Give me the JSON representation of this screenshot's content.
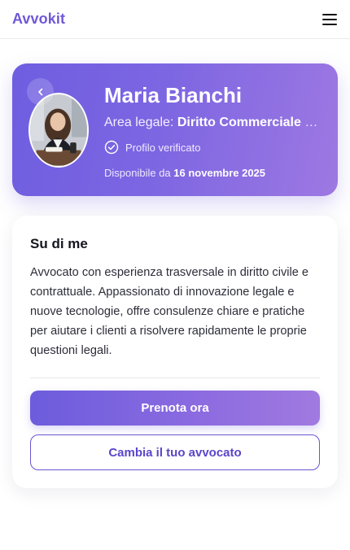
{
  "header": {
    "brand": "Avvokit",
    "menu_icon": "hamburger-menu-icon"
  },
  "profile": {
    "back_icon": "chevron-left-icon",
    "avatar_alt": "Maria Bianchi",
    "name": "Maria Bianchi",
    "area_label": "Area legale:",
    "area_value": "Diritto Commerciale e Societario",
    "verified_icon": "check-circle-icon",
    "verified_text": "Profilo verificato",
    "available_prefix": "Disponibile da",
    "available_date": "16 novembre 2025"
  },
  "about": {
    "title": "Su di me",
    "text": "Avvocato con esperienza trasversale in diritto civile e contrattuale. Appassionato di innovazione legale e nuove tecnologie, offre consulenze chiare e pratiche per aiutare i clienti a risolvere rapidamente le proprie questioni legali."
  },
  "actions": {
    "book_label": "Prenota ora",
    "change_label": "Cambia il tuo avvocato"
  },
  "colors": {
    "brand": "#7058d8",
    "hero_start": "#6e5ee0",
    "hero_end": "#9d78e2",
    "outline_text": "#5b45c9"
  }
}
